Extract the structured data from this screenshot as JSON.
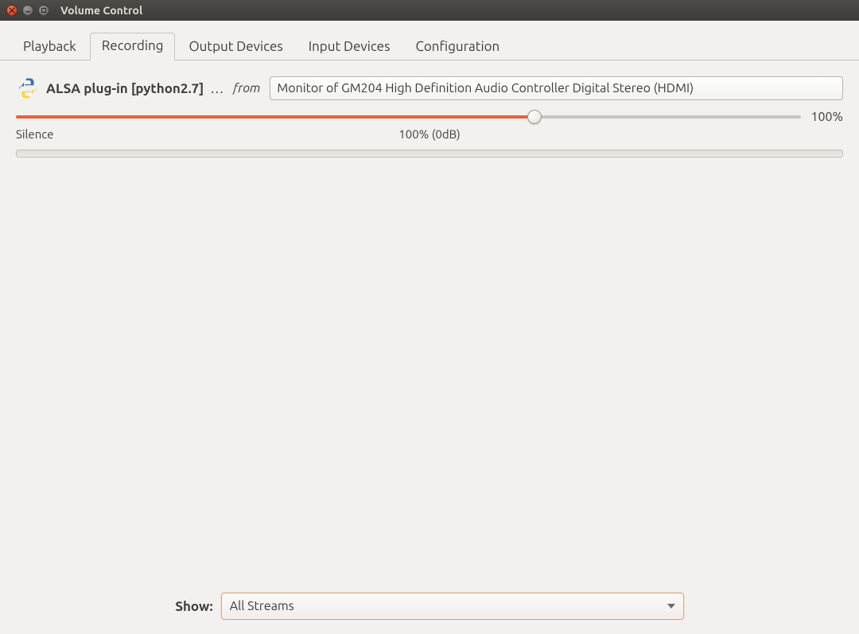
{
  "window": {
    "title": "Volume Control"
  },
  "tabs": {
    "playback": "Playback",
    "recording": "Recording",
    "output_devices": "Output Devices",
    "input_devices": "Input Devices",
    "configuration": "Configuration"
  },
  "stream": {
    "icon": "python-icon",
    "name": "ALSA plug-in [python2.7]",
    "truncated": "…",
    "from_label": "from",
    "source_selected": "Monitor of GM204 High Definition Audio Controller Digital Stereo (HDMI)",
    "slider": {
      "percent": 66,
      "value_text": "100%",
      "label_silence": "Silence",
      "label_center": "100% (0dB)"
    }
  },
  "footer": {
    "show_label": "Show:",
    "show_value": "All Streams"
  }
}
